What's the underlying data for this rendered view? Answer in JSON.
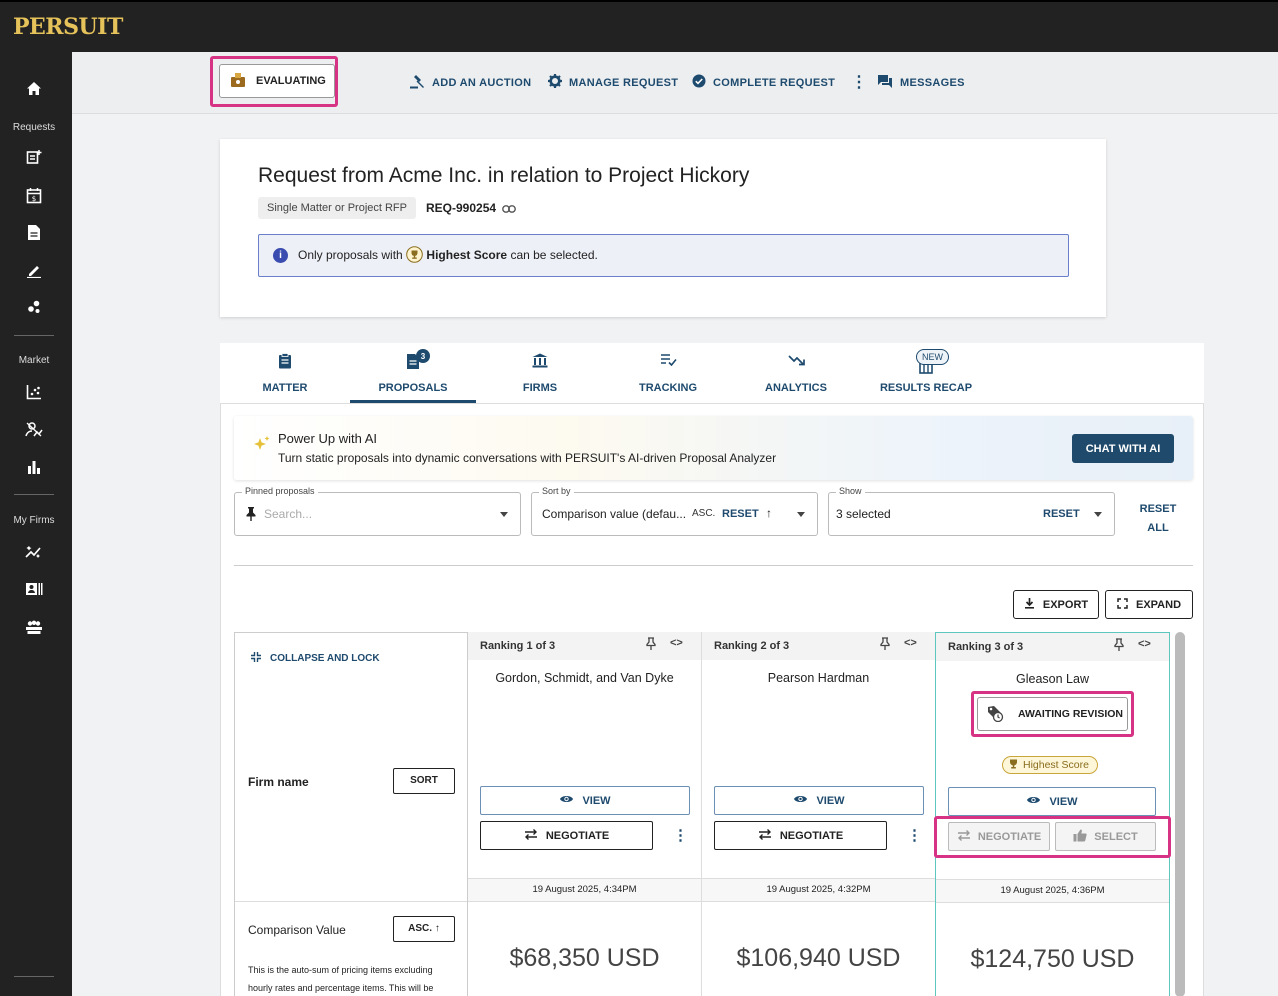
{
  "app": {
    "logo": "PERSUIT"
  },
  "sidebar": {
    "sections": [
      "Requests",
      "Market",
      "My Firms"
    ]
  },
  "actionbar": {
    "status_button": "EVALUATING",
    "add_auction": "ADD AN AUCTION",
    "manage_request": "MANAGE REQUEST",
    "complete_request": "COMPLETE REQUEST",
    "messages": "MESSAGES"
  },
  "request": {
    "title": "Request from Acme Inc. in relation to Project Hickory",
    "type_tag": "Single Matter or Project RFP",
    "id": "REQ-990254",
    "info_prefix": "Only proposals with",
    "info_bold": "Highest Score",
    "info_suffix": "can be selected."
  },
  "tabs": [
    {
      "label": "MATTER"
    },
    {
      "label": "PROPOSALS",
      "badge": "3"
    },
    {
      "label": "FIRMS"
    },
    {
      "label": "TRACKING"
    },
    {
      "label": "ANALYTICS"
    },
    {
      "label": "RESULTS RECAP",
      "badge": "NEW"
    }
  ],
  "ai_banner": {
    "title": "Power Up with AI",
    "subtitle": "Turn static proposals into dynamic conversations with PERSUIT's AI-driven Proposal Analyzer",
    "button": "CHAT WITH AI"
  },
  "filters": {
    "pinned": {
      "label": "Pinned proposals",
      "placeholder": "Search..."
    },
    "sort": {
      "label": "Sort by",
      "value": "Comparison value (defau...",
      "order": "ASC.",
      "reset": "RESET"
    },
    "show": {
      "label": "Show",
      "value": "3 selected",
      "reset": "RESET"
    },
    "reset_all_1": "RESET",
    "reset_all_2": "ALL"
  },
  "toolbar": {
    "export": "EXPORT",
    "expand": "EXPAND"
  },
  "left_column": {
    "collapse": "COLLAPSE AND LOCK",
    "firm_name": "Firm name",
    "sort_btn": "SORT",
    "comparison_value": "Comparison Value",
    "asc_btn": "ASC.",
    "note": "This is the auto-sum of pricing items excluding hourly rates and percentage items. This will be"
  },
  "proposals": [
    {
      "rank": "Ranking 1 of 3",
      "firm": "Gordon, Schmidt, and Van Dyke",
      "view": "VIEW",
      "negotiate": "NEGOTIATE",
      "date": "19 August 2025, 4:34PM",
      "price": "$68,350 USD"
    },
    {
      "rank": "Ranking 2 of 3",
      "firm": "Pearson Hardman",
      "view": "VIEW",
      "negotiate": "NEGOTIATE",
      "date": "19 August 2025, 4:32PM",
      "price": "$106,940 USD"
    },
    {
      "rank": "Ranking 3 of 3",
      "firm": "Gleason Law",
      "status": "AWAITING REVISION",
      "score_badge": "Highest Score",
      "view": "VIEW",
      "negotiate": "NEGOTIATE",
      "select": "SELECT",
      "date": "19 August 2025, 4:36PM",
      "price": "$124,750 USD"
    }
  ],
  "colors": {
    "accent": "#1e4a6e",
    "highlight": "#d63384",
    "sidebar": "#222222",
    "logo": "#e6c25a"
  }
}
